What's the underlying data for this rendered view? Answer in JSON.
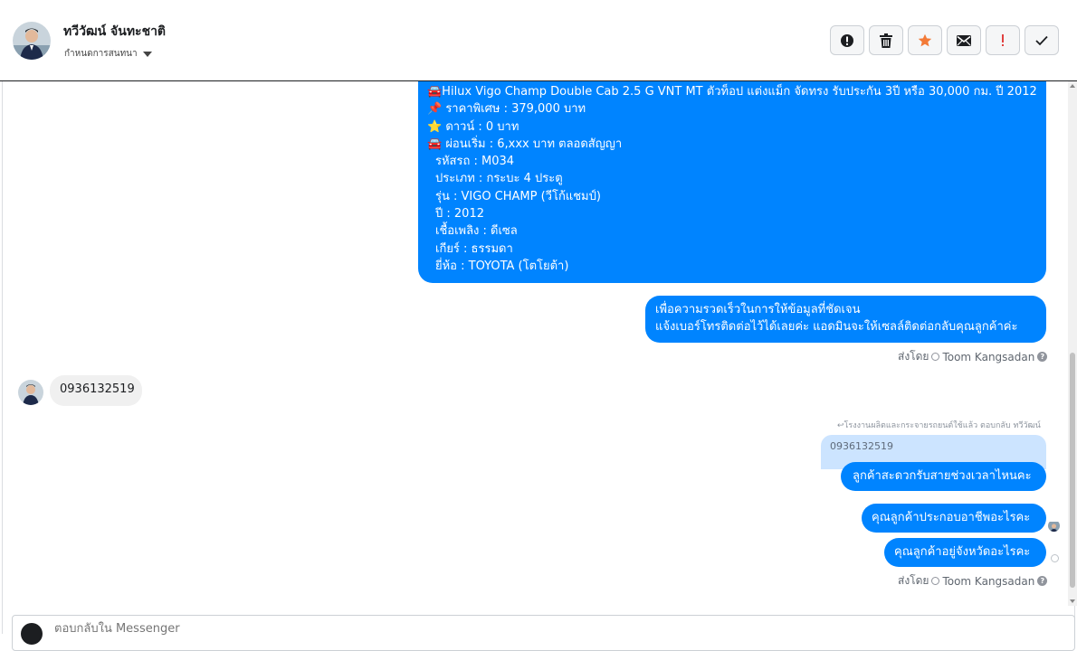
{
  "header": {
    "contact_name": "ทวีวัฒน์ จันทะชาติ",
    "assign_label": "กำหนดการสนทนา",
    "actions": [
      {
        "name": "report-spam-button",
        "icon": "alert-circle-icon"
      },
      {
        "name": "delete-button",
        "icon": "trash-icon"
      },
      {
        "name": "star-button",
        "icon": "star-icon"
      },
      {
        "name": "mark-unread-button",
        "icon": "envelope-icon"
      },
      {
        "name": "follow-up-button",
        "icon": "exclamation-icon"
      },
      {
        "name": "mark-done-button",
        "icon": "check-icon"
      }
    ]
  },
  "colors": {
    "outgoing_bubble": "#0084ff",
    "incoming_bubble": "#f0f0f0",
    "star": "#f37a37",
    "exclamation": "#e04040"
  },
  "messages": {
    "listing": {
      "title": "🚘Hilux Vigo Champ Double Cab 2.5 G VNT MT ตัวท็อป แต่งแม็ก จัดทรง รับประกัน 3ปี หรือ 30,000 กม. ปี 2012",
      "price": "📌 ราคาพิเศษ : 379,000 บาท",
      "down": "⭐ ดาวน์ : 0 บาท",
      "installment": "🚘 ผ่อนเริ่ม : 6,xxx บาท ตลอดสัญญา",
      "code": "รหัสรถ : M034",
      "type": "ประเภท : กระบะ 4 ประตู",
      "model": "รุ่น : VIGO CHAMP (วีโก้แชมป์)",
      "year": "ปี : 2012",
      "fuel": "เชื้อเพลิง : ดีเซล",
      "gear": "เกียร์ : ธรรมดา",
      "brand": "ยี่ห้อ : TOYOTA (โตโยต้า)"
    },
    "request": {
      "line1": "เพื่อความรวดเร็วในการให้ข้อมูลที่ชัดเจน",
      "line2": "แจ้งเบอร์โทรติดต่อไว้ได้เลยค่ะ แอดมินจะให้เซลล์ติดต่อกลับคุณลูกค้าค่ะ"
    },
    "sent_by_label": "ส่งโดย",
    "sent_by_name": "Toom Kangsadan",
    "customer_phone": "0936132519",
    "reply_meta": "↩โรงงานผลิตและกระจายรถยนต์ใช้แล้ว ตอบกลับ ทวีวัฒน์",
    "quoted_text": "0936132519",
    "reply1": "ลูกค้าสะดวกรับสายช่วงเวลาไหนคะ",
    "reply2": "คุณลูกค้าประกอบอาชีพอะไรคะ",
    "reply3": "คุณลูกค้าอยู่จังหวัดอะไรคะ"
  },
  "composer": {
    "placeholder": "ตอบกลับใน Messenger"
  }
}
